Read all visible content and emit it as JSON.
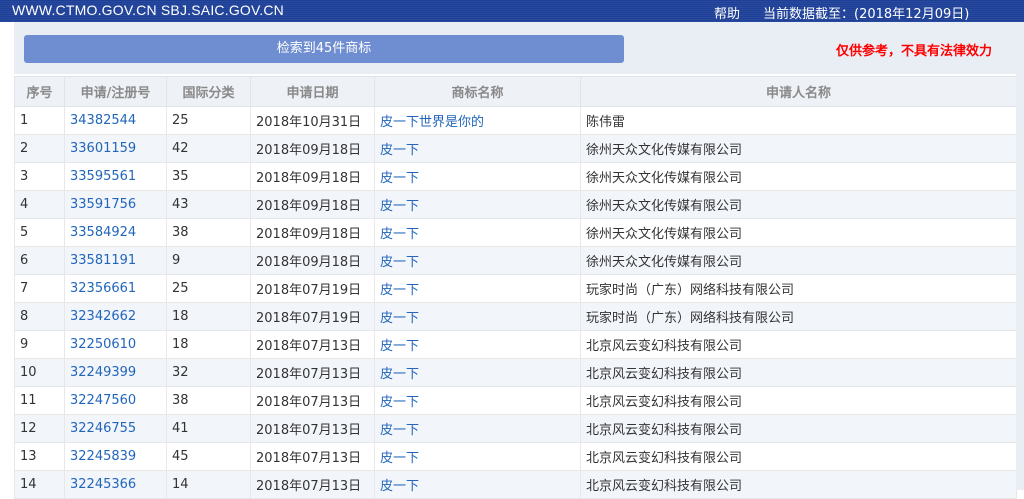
{
  "header": {
    "site": "WWW.CTMO.GOV.CN SBJ.SAIC.GOV.CN",
    "help": "帮助",
    "date_label": "当前数据截至：(2018年12月09日)"
  },
  "search": {
    "result_button": "检索到45件商标",
    "disclaimer": "仅供参考，不具有法律效力"
  },
  "table": {
    "columns": [
      "序号",
      "申请/注册号",
      "国际分类",
      "申请日期",
      "商标名称",
      "申请人名称"
    ],
    "rows": [
      {
        "no": "1",
        "reg": "34382544",
        "cls": "25",
        "date": "2018年10月31日",
        "mark": "皮一下世界是你的",
        "applicant": "陈伟雷"
      },
      {
        "no": "2",
        "reg": "33601159",
        "cls": "42",
        "date": "2018年09月18日",
        "mark": "皮一下",
        "applicant": "徐州天众文化传媒有限公司"
      },
      {
        "no": "3",
        "reg": "33595561",
        "cls": "35",
        "date": "2018年09月18日",
        "mark": "皮一下",
        "applicant": "徐州天众文化传媒有限公司"
      },
      {
        "no": "4",
        "reg": "33591756",
        "cls": "43",
        "date": "2018年09月18日",
        "mark": "皮一下",
        "applicant": "徐州天众文化传媒有限公司"
      },
      {
        "no": "5",
        "reg": "33584924",
        "cls": "38",
        "date": "2018年09月18日",
        "mark": "皮一下",
        "applicant": "徐州天众文化传媒有限公司"
      },
      {
        "no": "6",
        "reg": "33581191",
        "cls": "9",
        "date": "2018年09月18日",
        "mark": "皮一下",
        "applicant": "徐州天众文化传媒有限公司"
      },
      {
        "no": "7",
        "reg": "32356661",
        "cls": "25",
        "date": "2018年07月19日",
        "mark": "皮一下",
        "applicant": "玩家时尚（广东）网络科技有限公司"
      },
      {
        "no": "8",
        "reg": "32342662",
        "cls": "18",
        "date": "2018年07月19日",
        "mark": "皮一下",
        "applicant": "玩家时尚（广东）网络科技有限公司"
      },
      {
        "no": "9",
        "reg": "32250610",
        "cls": "18",
        "date": "2018年07月13日",
        "mark": "皮一下",
        "applicant": "北京风云变幻科技有限公司"
      },
      {
        "no": "10",
        "reg": "32249399",
        "cls": "32",
        "date": "2018年07月13日",
        "mark": "皮一下",
        "applicant": "北京风云变幻科技有限公司"
      },
      {
        "no": "11",
        "reg": "32247560",
        "cls": "38",
        "date": "2018年07月13日",
        "mark": "皮一下",
        "applicant": "北京风云变幻科技有限公司"
      },
      {
        "no": "12",
        "reg": "32246755",
        "cls": "41",
        "date": "2018年07月13日",
        "mark": "皮一下",
        "applicant": "北京风云变幻科技有限公司"
      },
      {
        "no": "13",
        "reg": "32245839",
        "cls": "45",
        "date": "2018年07月13日",
        "mark": "皮一下",
        "applicant": "北京风云变幻科技有限公司"
      },
      {
        "no": "14",
        "reg": "32245366",
        "cls": "14",
        "date": "2018年07月13日",
        "mark": "皮一下",
        "applicant": "北京风云变幻科技有限公司"
      }
    ]
  },
  "colors": {
    "header_bg": "#1d3f97",
    "button_bg": "#6f8ed1",
    "link": "#2266bb",
    "warning": "#ff0000"
  }
}
